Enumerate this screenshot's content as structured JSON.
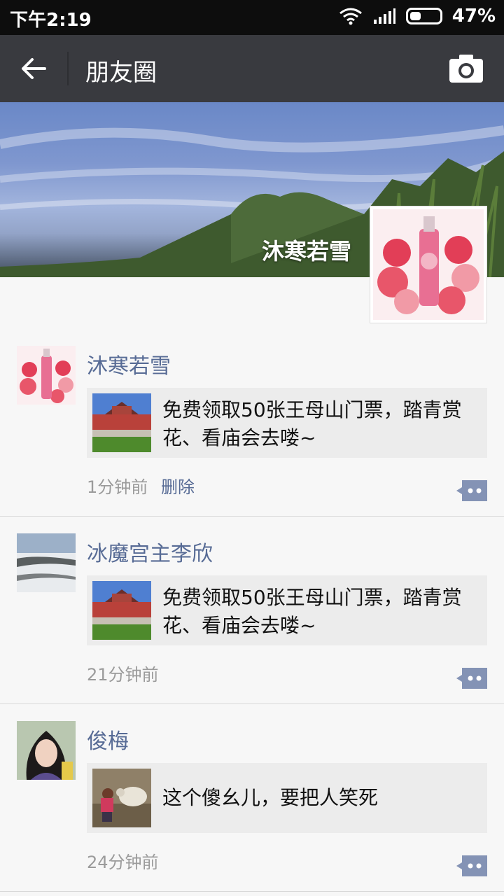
{
  "status": {
    "time": "下午2:19",
    "battery_percent": "47%",
    "battery_level": 0.47
  },
  "header": {
    "title": "朋友圈"
  },
  "cover": {
    "username": "沐寒若雪"
  },
  "posts": [
    {
      "name": "沐寒若雪",
      "text": "免费领取50张王母山门票，踏青赏花、看庙会去喽~",
      "time": "1分钟前",
      "delete_label": "删除"
    },
    {
      "name": "冰魔宫主李欣",
      "text": "免费领取50张王母山门票，踏青赏花、看庙会去喽~",
      "time": "21分钟前"
    },
    {
      "name": "俊梅",
      "text": "这个傻幺儿，要把人笑死",
      "time": "24分钟前"
    }
  ],
  "colors": {
    "titlebar": "#393a3f",
    "link": "#576b95",
    "card": "#ececec"
  }
}
